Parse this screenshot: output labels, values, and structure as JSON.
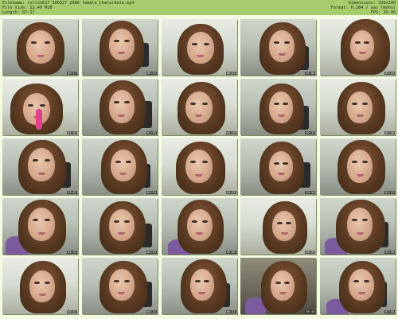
{
  "header": {
    "filename_label": "Filename:",
    "filename": "rollin627_100327_2086_female_Chaturbate.mp4",
    "filesize_label": "File size:",
    "filesize": "12.40 MiB",
    "length_label": "Length:",
    "length": "07:17",
    "dimensions_label": "Dimensions:",
    "dimensions": "320x240",
    "format_label": "Format:",
    "format": "H.264 / aac (mono)",
    "fps_label": "FPS:",
    "fps": "30.00"
  },
  "thumbnails": [
    {
      "time": "00:17"
    },
    {
      "time": "00:34"
    },
    {
      "time": "00:51"
    },
    {
      "time": "01:08"
    },
    {
      "time": "01:25"
    },
    {
      "time": "01:42"
    },
    {
      "time": "01:59"
    },
    {
      "time": "02:16"
    },
    {
      "time": "02:33"
    },
    {
      "time": "02:50"
    },
    {
      "time": "03:07"
    },
    {
      "time": "03:24"
    },
    {
      "time": "03:41"
    },
    {
      "time": "03:58"
    },
    {
      "time": "04:15"
    },
    {
      "time": "04:32"
    },
    {
      "time": "04:49"
    },
    {
      "time": "05:06"
    },
    {
      "time": "05:23"
    },
    {
      "time": "05:40"
    },
    {
      "time": "05:57"
    },
    {
      "time": "06:14"
    },
    {
      "time": "06:31"
    },
    {
      "time": "06:48"
    },
    {
      "time": "07:05"
    }
  ]
}
